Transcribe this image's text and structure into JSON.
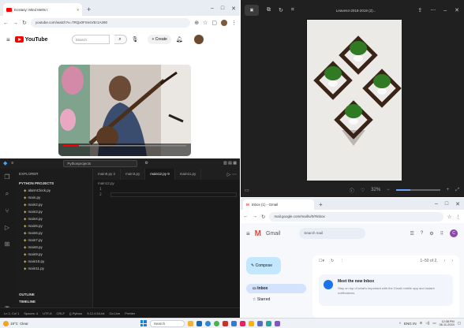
{
  "browser": {
    "tab_title": "Ecstasy: Mind Melts t",
    "tab_close": "×",
    "new_tab": "+",
    "url": "youtube.com/watch?v=7RQx0FSnsVEr1A290",
    "yt_brand": "YouTube",
    "yt_search_placeholder": "Search",
    "yt_create": "+ Create"
  },
  "editor": {
    "search_text": "Pythonprojects",
    "explorer_title": "EXPLORER",
    "section_open": "PYTHON PROJECTS",
    "files": [
      "alarmClock.py",
      "main.py",
      "main2.py",
      "main3.py",
      "main4.py",
      "main5.py",
      "main6.py",
      "main7.py",
      "main8.py",
      "main9.py",
      "main10.py",
      "main11.py"
    ],
    "outline": "OUTLINE",
    "timeline": "TIMELINE",
    "tabs": [
      "main9.py 2",
      "main3.py",
      "main12.py 9",
      "main11.py"
    ],
    "breadcrumb": "main12.py",
    "status": [
      "Ln 2, Col 1",
      "Spaces: 4",
      "UTF-8",
      "CRLF",
      "{} Python",
      "3.12.4 64-bit",
      "Go Live",
      "Prettier"
    ]
  },
  "viewer": {
    "title": "Leaves4-2018-2019 (2)...",
    "zoom": "32%"
  },
  "gmail": {
    "tab_title": "Inbox (1) - Gmail",
    "url": "mail.google.com/mail/u/0/#inbox",
    "brand": "Gmail",
    "search_placeholder": "Search mail",
    "compose": "Compose",
    "nav": [
      "Inbox",
      "Starred"
    ],
    "page_count": "1–50 of 2,",
    "promo_title": "Meet the new Inbox",
    "promo_sub": "Stay on top of what's important with the Gmail mobile app and instant notifications."
  },
  "taskbar": {
    "temp": "19°C",
    "weather": "Clear",
    "search": "Search",
    "lang": "ENG",
    "region": "IN",
    "time": "12:38 PM",
    "date": "06-11-2024"
  },
  "colors": {
    "yt_red": "#ff0000",
    "gmail_red": "#ea4335",
    "vscode_bg": "#181818",
    "accent": "#1a73e8"
  }
}
